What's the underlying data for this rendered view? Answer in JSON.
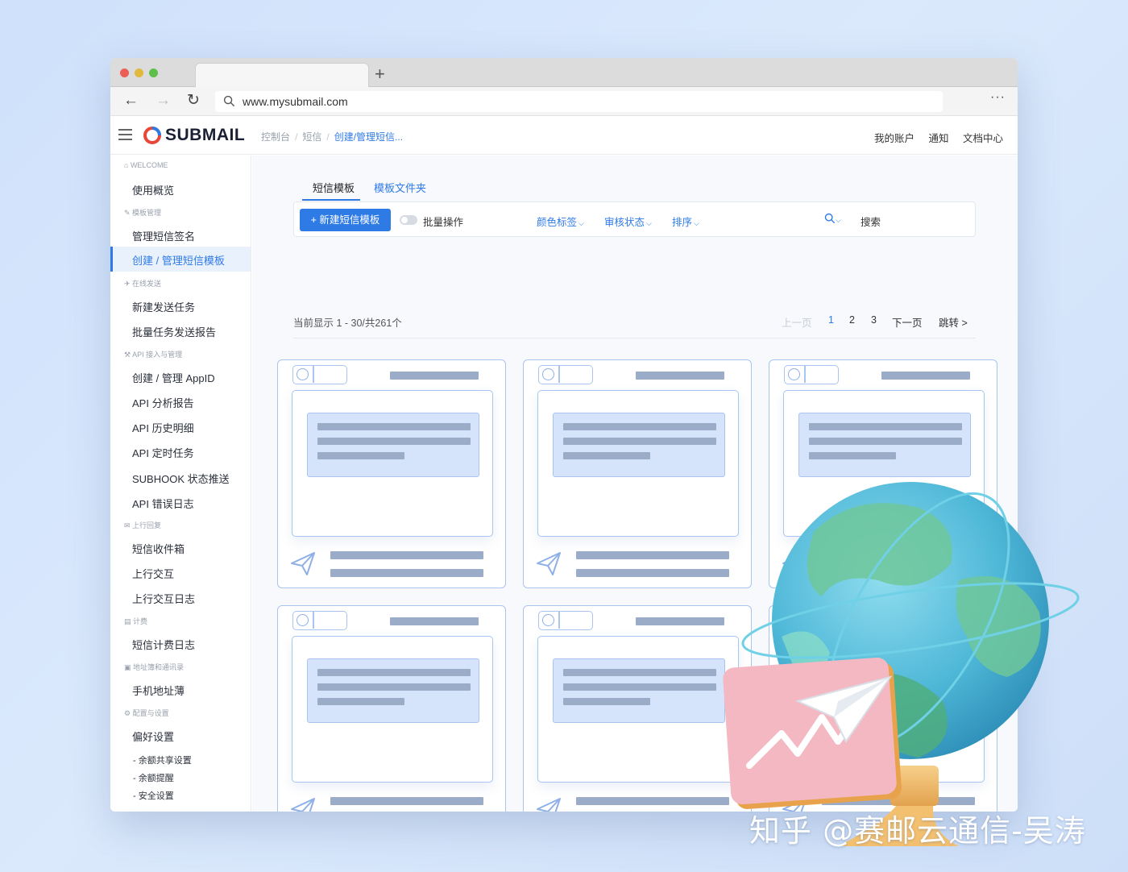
{
  "browser": {
    "new_tab_label": "+",
    "url": "www.mysubmail.com",
    "more_label": "···",
    "back_label": "←",
    "forward_label": "→",
    "reload_label": "↻"
  },
  "header": {
    "logo_text": "SUBMAIL",
    "breadcrumb": [
      "控制台",
      "短信",
      "创建/管理短信..."
    ],
    "nav": [
      "我的账户",
      "通知",
      "文档中心"
    ]
  },
  "sidebar": {
    "sections": [
      {
        "label": "WELCOME",
        "items": [
          "使用概览"
        ]
      },
      {
        "label": "模板管理",
        "items": [
          "管理短信签名",
          "创建 / 管理短信模板"
        ]
      },
      {
        "label": "在线发送",
        "items": [
          "新建发送任务",
          "批量任务发送报告"
        ]
      },
      {
        "label": "API 接入与管理",
        "items": [
          "创建 / 管理 AppID",
          "API 分析报告",
          "API 历史明细",
          "API 定时任务",
          "SUBHOOK 状态推送",
          "API 错误日志"
        ]
      },
      {
        "label": "上行回复",
        "items": [
          "短信收件箱",
          "上行交互",
          "上行交互日志"
        ]
      },
      {
        "label": "计费",
        "items": [
          "短信计费日志"
        ]
      },
      {
        "label": "地址簿和通讯录",
        "items": [
          "手机地址薄"
        ]
      },
      {
        "label": "配置与设置",
        "items": [
          "偏好设置"
        ]
      }
    ],
    "sub_items": [
      "- 余额共享设置",
      "- 余额提醒",
      "- 安全设置"
    ],
    "active_item": "创建 / 管理短信模板"
  },
  "main": {
    "tabs": [
      {
        "label": "短信模板",
        "active": true
      },
      {
        "label": "模板文件夹",
        "active": false
      }
    ],
    "toolbar": {
      "new_button": "+ 新建短信模板",
      "bulk_label": "批量操作",
      "bulk_enabled": false,
      "filters": [
        "颜色标签",
        "审核状态",
        "排序"
      ],
      "search_label": "搜索"
    },
    "info": "当前显示 1 - 30/共261个",
    "pagination": {
      "prev": "上一页",
      "pages": [
        "1",
        "2",
        "3"
      ],
      "current_page": "1",
      "next": "下一页",
      "jump": "跳转 >"
    }
  },
  "watermark": "知乎 @赛邮云通信-吴涛",
  "colors": {
    "accent": "#2f7be6",
    "card_border": "#a8c4ef",
    "placeholder": "#9aacc8",
    "bubble": "#d5e4fb"
  }
}
